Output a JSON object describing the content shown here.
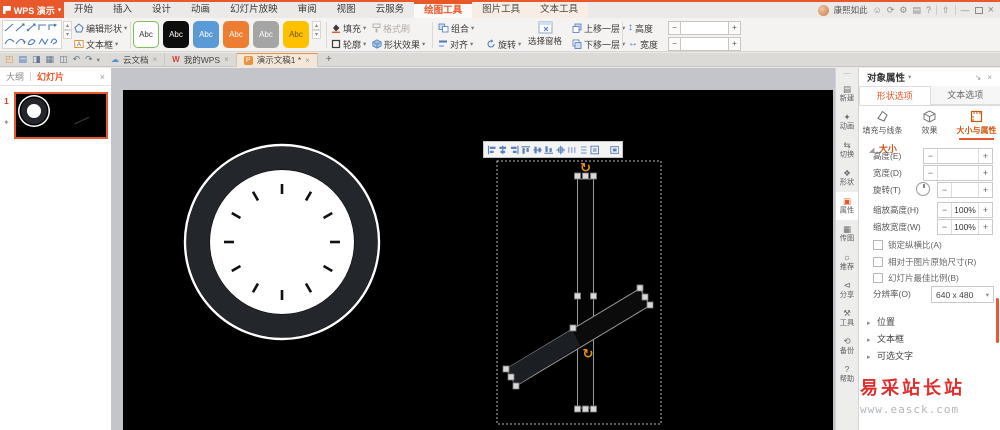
{
  "titlebar": {
    "app_name": "WPS 演示",
    "menu_tabs": [
      "开始",
      "插入",
      "设计",
      "动画",
      "幻灯片放映",
      "审阅",
      "视图",
      "云服务"
    ],
    "context_tabs": [
      "绘图工具",
      "图片工具",
      "文本工具"
    ],
    "active_context_tab": "绘图工具",
    "user_name": "康熙如此"
  },
  "ribbon": {
    "edit_shape": "编辑形状",
    "text_box": "文本框",
    "style_swatches": [
      {
        "label": "Abc",
        "bg": "#ffffff",
        "border": "#7fbf5f"
      },
      {
        "label": "Abc",
        "bg": "#0d0d0d"
      },
      {
        "label": "Abc",
        "bg": "#5b9bd5"
      },
      {
        "label": "Abc",
        "bg": "#ed7d31"
      },
      {
        "label": "Abc",
        "bg": "#a5a5a5"
      },
      {
        "label": "Abc",
        "bg": "#ffc000"
      }
    ],
    "fill": "填充",
    "format_painter": "格式刷",
    "outline": "轮廓",
    "shape_effects": "形状效果",
    "group": "组合",
    "align": "对齐",
    "rotate": "旋转",
    "selection_pane": "选择窗格",
    "bring_forward": "上移一层",
    "send_backward": "下移一层",
    "height": "高度",
    "width": "宽度"
  },
  "doc_tabs": {
    "tabs": [
      {
        "label": "云文档"
      },
      {
        "label": "我的WPS"
      },
      {
        "label": "演示文稿1 *"
      }
    ],
    "active": "演示文稿1 *"
  },
  "sidebar": {
    "outline_tab": "大纲",
    "slides_tab": "幻灯片",
    "slide_number": "1"
  },
  "rail": {
    "items": [
      {
        "label": "新建",
        "icon": "▤"
      },
      {
        "label": "动画",
        "icon": "✦"
      },
      {
        "label": "切换",
        "icon": "⇆"
      },
      {
        "label": "形状",
        "icon": "❖"
      },
      {
        "label": "属性",
        "icon": "▣"
      },
      {
        "label": "传图",
        "icon": "▦"
      },
      {
        "label": "推荐",
        "icon": "☼"
      },
      {
        "label": "分享",
        "icon": "⊲"
      },
      {
        "label": "工具",
        "icon": "⚒"
      },
      {
        "label": "备份",
        "icon": "⟲"
      },
      {
        "label": "帮助",
        "icon": "?"
      }
    ],
    "active": "属性"
  },
  "panel": {
    "title": "对象属性",
    "tab_shape": "形状选项",
    "tab_text": "文本选项",
    "subtab_fill": "填充与线条",
    "subtab_effects": "效果",
    "subtab_size": "大小与属性",
    "active_subtab": "大小与属性",
    "size_section": "大小",
    "rows": {
      "height": {
        "label": "高度(E)",
        "value": ""
      },
      "width": {
        "label": "宽度(D)",
        "value": ""
      },
      "rotate": {
        "label": "旋转(T)",
        "value": ""
      },
      "scale_h": {
        "label": "缩放高度(H)",
        "value": "100%"
      },
      "scale_w": {
        "label": "缩放宽度(W)",
        "value": "100%"
      }
    },
    "checkboxes": [
      "锁定纵横比(A)",
      "相对于图片原始尺寸(R)",
      "幻灯片最佳比例(B)"
    ],
    "resolution_label": "分辨率(O)",
    "resolution_value": "640 x 480",
    "sections": [
      "位置",
      "文本框",
      "可选文字"
    ]
  },
  "slide": {
    "background": "#000000",
    "clock": {
      "outer_ring": "#ffffff",
      "band": "#23262b",
      "face": "#ffffff",
      "tick": "#111111",
      "tick_count": 12
    }
  },
  "watermark": {
    "line1": "易采站长站",
    "line2": "www.easck.com"
  },
  "colors": {
    "accent": "#e8582a",
    "selection_handle": "#d9d9d9",
    "rotation_handle": "#e8930c"
  },
  "icons": {
    "dropdown": "▾",
    "close": "×",
    "minimize": "—",
    "plus": "+",
    "minus": "−",
    "smiley": "☺",
    "gear": "⚙",
    "refresh": "⟳",
    "help": "?",
    "undo": "↶",
    "redo": "↷",
    "updown": "↕",
    "leftright": "↔",
    "spin_up": "▴",
    "spin_down": "▾",
    "tri_right": "▸",
    "tri_expanded": "◢",
    "add_tab": "+",
    "cloud": "☁",
    "wps_w": "W",
    "ppt": "P",
    "star": "✦",
    "collapse_ribbon": "⇧",
    "panel_expand": "↘",
    "rotate_handle": "↻",
    "folder": "◰",
    "save": "▤",
    "export": "◨",
    "print": "▦",
    "preview": "◫"
  }
}
